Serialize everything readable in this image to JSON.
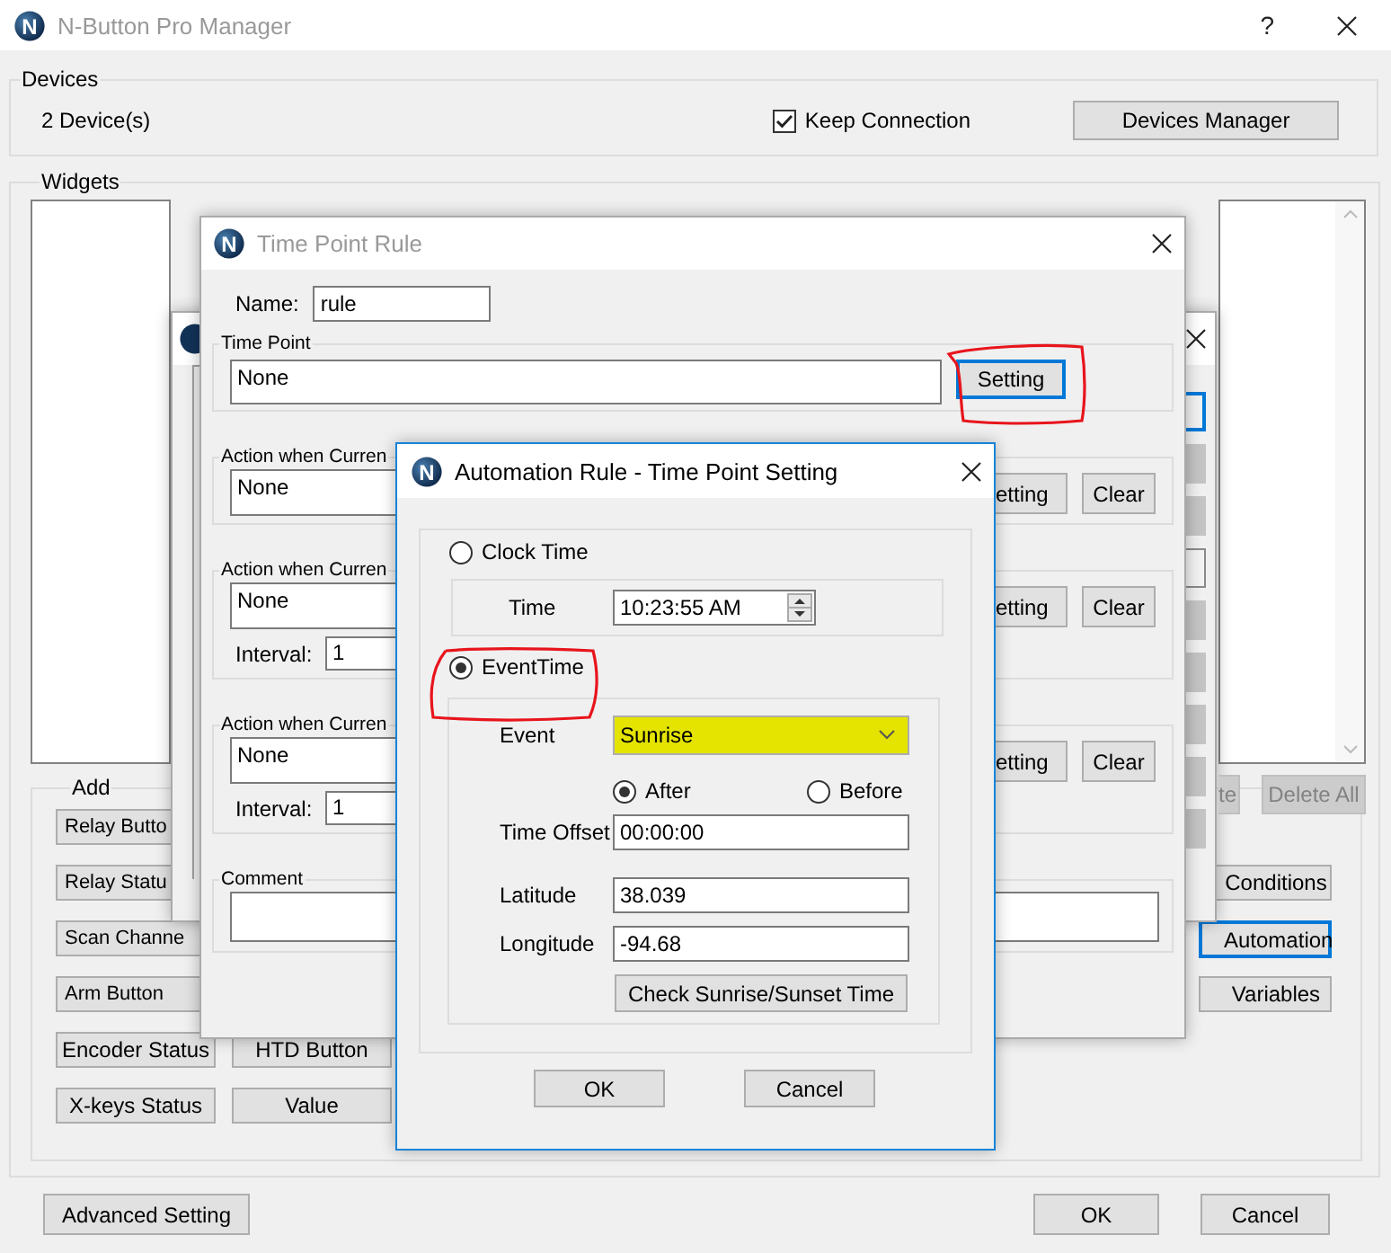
{
  "main_window": {
    "logo": "N",
    "title": "N-Button Pro Manager",
    "active": false,
    "help": "?"
  },
  "devices": {
    "label": "Devices",
    "count": "2 Device(s)",
    "keep_connection": {
      "label": "Keep Connection",
      "checked": true
    },
    "manager_button": "Devices Manager"
  },
  "widgets": {
    "label": "Widgets",
    "list_buttons": [
      {
        "label": "te",
        "disabled": true,
        "covered": true
      },
      {
        "label": "Delete All",
        "disabled": true,
        "covered": false
      }
    ],
    "add": {
      "label": "Add",
      "left_buttons": [
        {
          "label": "Relay Butto",
          "covered": true
        },
        {
          "label": "Relay Statu",
          "covered": true
        },
        {
          "label": "Scan Channe",
          "covered": true
        },
        {
          "label": "Arm Button",
          "covered": true
        },
        {
          "label": "Encoder Status",
          "covered": false
        },
        {
          "label": "X-keys Status",
          "covered": false
        }
      ],
      "middle_buttons": [
        {
          "label": "HTD Button"
        },
        {
          "label": "Value"
        }
      ],
      "right_buttons": [
        {
          "label": "Conditions",
          "focused": false
        },
        {
          "label": "Automation",
          "focused": true
        },
        {
          "label": "Variables",
          "focused": false
        }
      ]
    }
  },
  "footer": {
    "advanced_button": "Advanced Setting",
    "ok_button": "OK",
    "cancel_button": "Cancel"
  },
  "back_dialog": {
    "side_buttons": [
      {
        "focused": true,
        "disabled": false
      },
      {
        "focused": false,
        "disabled": true
      },
      {
        "focused": false,
        "disabled": true
      },
      {
        "focused": false,
        "disabled": false
      },
      {
        "focused": false,
        "disabled": true
      },
      {
        "focused": false,
        "disabled": true
      },
      {
        "focused": false,
        "disabled": true
      },
      {
        "focused": false,
        "disabled": true
      },
      {
        "focused": false,
        "disabled": true
      }
    ]
  },
  "rule_dialog": {
    "logo": "N",
    "title": "Time Point Rule",
    "active": false,
    "name": {
      "label": "Name:",
      "value": "rule"
    },
    "time_point": {
      "label": "Time Point",
      "value": "None",
      "button": {
        "label": "Setting",
        "focused": true
      }
    },
    "actions": [
      {
        "label": "Action when Curren",
        "value": "None",
        "setting_button": "etting",
        "clear_button": "Clear"
      },
      {
        "label": "Action when Curren",
        "value": "None",
        "interval": {
          "label": "Interval:",
          "value": "1"
        },
        "setting_button": "etting",
        "clear_button": "Clear"
      },
      {
        "label": "Action when Curren",
        "value": "None",
        "interval": {
          "label": "Interval:",
          "value": "1"
        },
        "setting_button": "etting",
        "clear_button": "Clear"
      }
    ],
    "comment": {
      "label": "Comment"
    }
  },
  "setting_dialog": {
    "logo": "N",
    "title": "Automation Rule - Time Point Setting",
    "active": true,
    "modes": [
      {
        "label": "Clock Time",
        "selected": false
      },
      {
        "label": "EventTime",
        "selected": true
      }
    ],
    "time": {
      "label": "Time",
      "value": "10:23:55 AM"
    },
    "event": {
      "label": "Event",
      "value": "Sunrise",
      "highlighted": true
    },
    "direction": [
      {
        "label": "After",
        "selected": true
      },
      {
        "label": "Before",
        "selected": false
      }
    ],
    "offset": {
      "label": "Time Offset",
      "value": "00:00:00"
    },
    "latitude": {
      "label": "Latitude",
      "value": "38.039"
    },
    "longitude": {
      "label": "Longitude",
      "value": "-94.68"
    },
    "check_button": "Check Sunrise/Sunset Time",
    "ok_button": "OK",
    "cancel_button": "Cancel"
  }
}
